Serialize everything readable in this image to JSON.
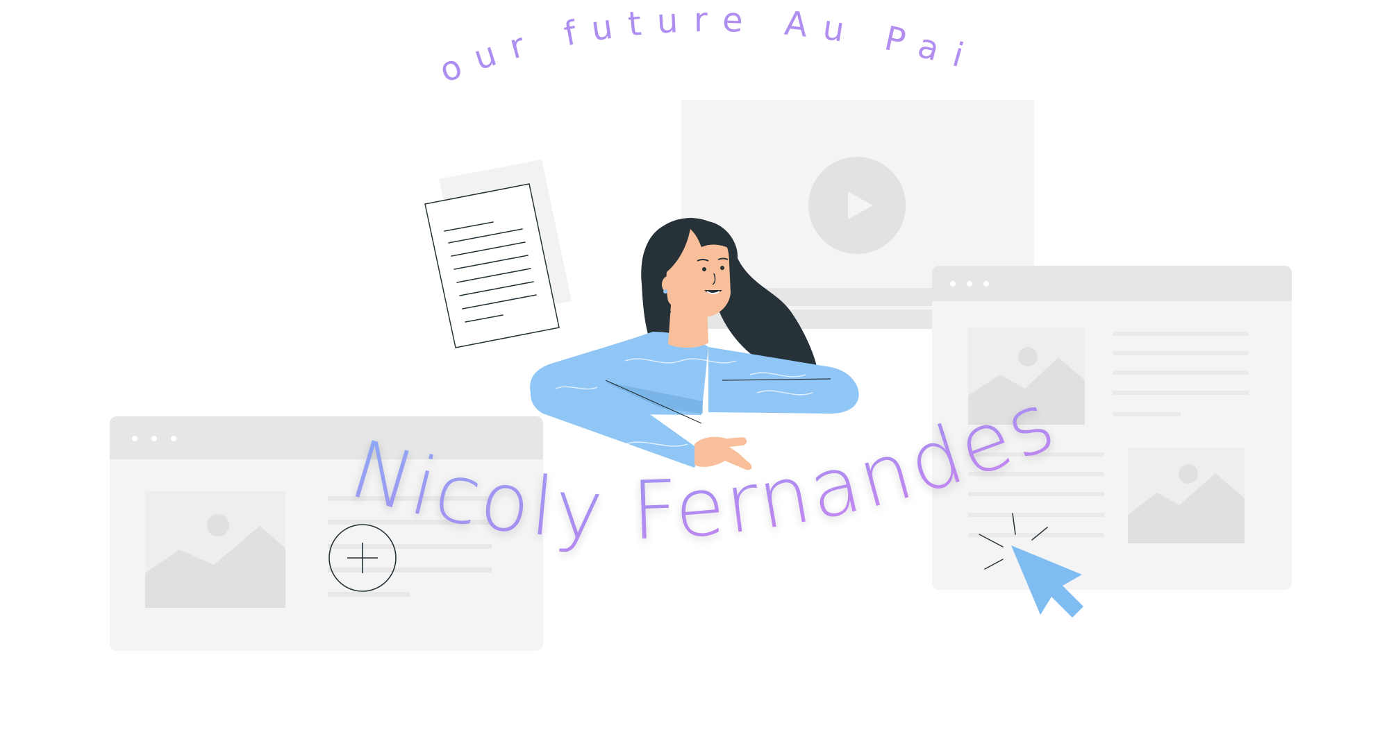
{
  "tagline": "Your future Au Pair!",
  "name": "Nicoly Fernandes",
  "colors": {
    "background": "#ffffff",
    "mockup_fill": "#f4f4f4",
    "mockup_bar": "#e6e6e6",
    "mockup_shape": "#e2e2e2",
    "shirt": "#8fc6f5",
    "hair": "#263238",
    "skin": "#f9bf9a",
    "cursor": "#7fbcf2",
    "gradient_start": "#7fb6f7",
    "gradient_mid": "#a98df0",
    "gradient_end": "#e57ef0"
  },
  "icons": {
    "play": "play-icon",
    "cursor": "cursor-arrow-icon",
    "crosshair": "crosshair-icon",
    "document": "document-icon",
    "image_placeholder": "image-placeholder-icon"
  }
}
